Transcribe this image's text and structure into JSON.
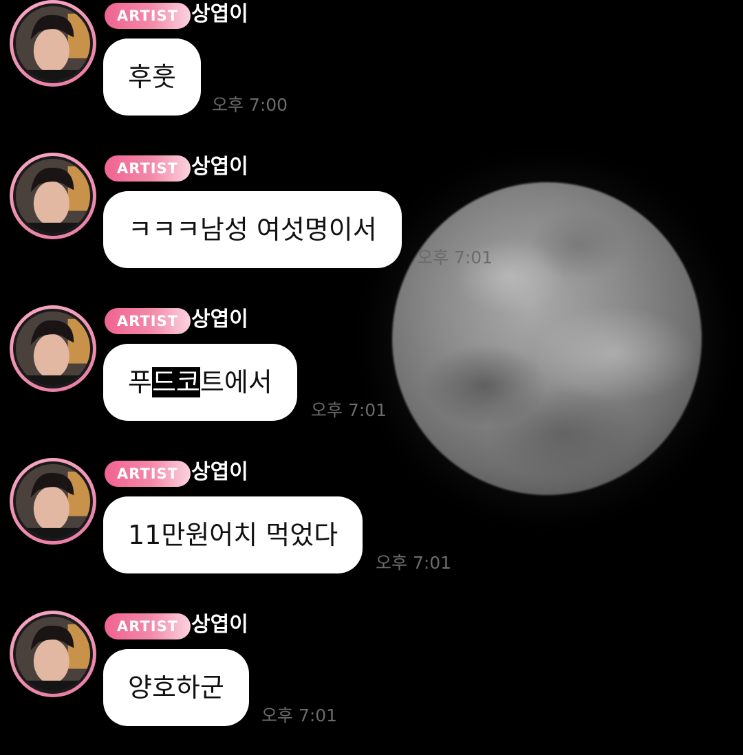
{
  "chat": {
    "badge_label": "ARTIST",
    "sender_name": "상엽이",
    "messages": [
      {
        "text": "후훗",
        "time": "오후 7:00"
      },
      {
        "text": "ㅋㅋㅋ남성 여섯명이서",
        "time": "오후 7:01"
      },
      {
        "text_before": "푸",
        "text_highlight": "드코",
        "text_after": "트에서",
        "time": "오후 7:01"
      },
      {
        "text": "11만원어치 먹었다",
        "time": "오후 7:01"
      },
      {
        "text": "양호하군",
        "time": "오후 7:01"
      }
    ]
  },
  "colors": {
    "background": "#000000",
    "badge_gradient_start": "#f06391",
    "badge_gradient_end": "#fbd3e0",
    "avatar_ring": "#f7a9c4",
    "bubble": "#ffffff",
    "timestamp": "#6b6b6b"
  }
}
